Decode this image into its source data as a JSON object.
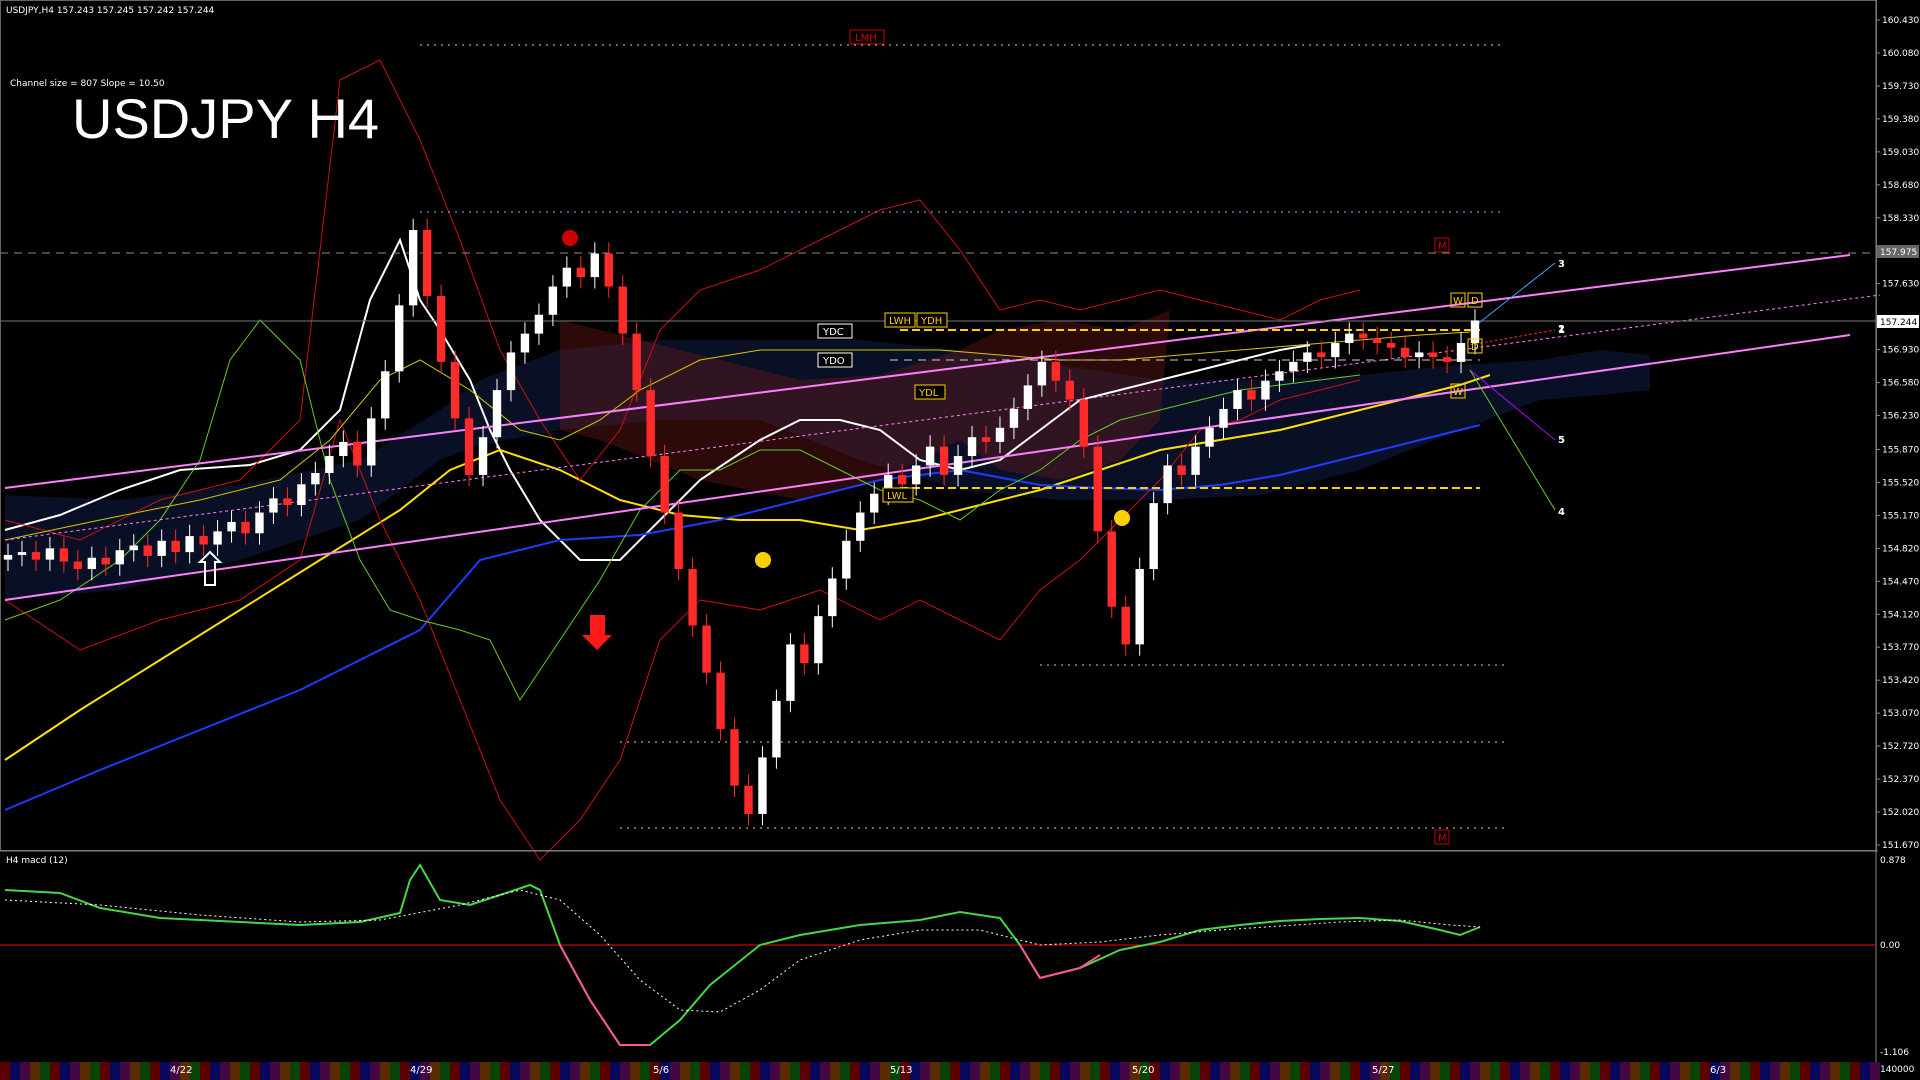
{
  "header": {
    "info": "USDJPY,H4  157.243 157.245 157.242 157.244",
    "channel_info": "Channel size = 807 Slope = 10.50",
    "title": "USDJPY H4"
  },
  "chart_data": [
    {
      "type": "candlestick",
      "symbol": "USDJPY",
      "timeframe": "H4",
      "title": "USDJPY H4",
      "ohlc_last": {
        "open": 157.243,
        "high": 157.245,
        "low": 157.242,
        "close": 157.244
      },
      "ylim": [
        151.67,
        160.3
      ],
      "y_ticks": [
        "160.430",
        "160.080",
        "159.730",
        "159.380",
        "159.030",
        "158.680",
        "158.330",
        "157.975",
        "157.630",
        "157.244",
        "156.930",
        "156.580",
        "156.230",
        "155.870",
        "155.520",
        "155.170",
        "154.820",
        "154.470",
        "154.120",
        "153.770",
        "153.420",
        "153.070",
        "152.720",
        "152.370",
        "152.020",
        "151.670"
      ],
      "current_price": "157.244",
      "marked_price": "157.975",
      "x_ticks": [
        "4/22",
        "4/29",
        "5/6",
        "5/13",
        "5/20",
        "5/27",
        "6/3"
      ],
      "level_labels": [
        "LMH",
        "M",
        "M",
        "YDC",
        "YDO",
        "LWH",
        "YDH",
        "YDL",
        "LWL",
        "W",
        "D",
        "D",
        "W"
      ],
      "projection_labels": [
        "3",
        "2",
        "1",
        "5",
        "4"
      ],
      "closes": [
        154.75,
        154.78,
        154.7,
        154.82,
        154.68,
        154.6,
        154.72,
        154.65,
        154.8,
        154.85,
        154.74,
        154.9,
        154.78,
        154.95,
        154.86,
        155.0,
        155.1,
        154.98,
        155.2,
        155.35,
        155.28,
        155.5,
        155.62,
        155.8,
        155.95,
        155.7,
        156.2,
        156.7,
        157.4,
        158.2,
        157.5,
        156.8,
        156.2,
        155.6,
        156.0,
        156.5,
        156.9,
        157.1,
        157.3,
        157.6,
        157.8,
        157.7,
        157.95,
        157.6,
        157.1,
        156.5,
        155.8,
        155.2,
        154.6,
        154.0,
        153.5,
        152.9,
        152.3,
        152.0,
        152.6,
        153.2,
        153.8,
        153.6,
        154.1,
        154.5,
        154.9,
        155.2,
        155.4,
        155.6,
        155.5,
        155.7,
        155.9,
        155.6,
        155.8,
        156.0,
        155.95,
        156.1,
        156.3,
        156.55,
        156.8,
        156.6,
        156.4,
        155.9,
        155.0,
        154.2,
        153.8,
        154.6,
        155.3,
        155.7,
        155.6,
        155.9,
        156.1,
        156.3,
        156.5,
        156.4,
        156.6,
        156.7,
        156.8,
        156.9,
        156.85,
        157.0,
        157.1,
        157.05,
        157.0,
        156.95,
        156.85,
        156.9,
        156.85,
        156.8,
        157.0,
        157.24
      ],
      "macd": {
        "name": "H4 macd (12)",
        "ylim": [
          -1.106,
          0.878
        ],
        "y_ticks": [
          "0.878",
          "0.00",
          "-1.106"
        ]
      },
      "bottom_label": "140000"
    }
  ]
}
